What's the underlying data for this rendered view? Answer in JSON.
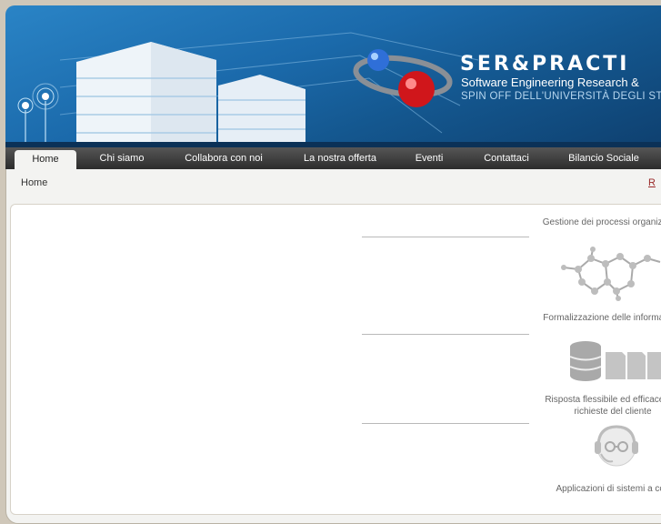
{
  "header": {
    "title": "SER&PRACTI",
    "subtitle": "Software Engineering Research &",
    "spin_off": "SPIN OFF DELL'UNIVERSITÀ DEGLI ST"
  },
  "nav": {
    "items": [
      "Home",
      "Chi siamo",
      "Collabora con noi",
      "La nostra offerta",
      "Eventi",
      "Contattaci",
      "Bilancio Sociale"
    ],
    "active": "Home"
  },
  "breadcrumb": {
    "current": "Home",
    "right_link": "R"
  },
  "features": [
    {
      "label": "Gestione dei processi organizzativi",
      "icon": "molecule-network-icon"
    },
    {
      "label": "Formalizzazione delle informazioni",
      "icon": "database-documents-icon"
    },
    {
      "label": "Risposta flessibile ed efficace alle richieste del cliente",
      "icon": "headset-face-icon"
    },
    {
      "label": "Applicazioni di sistemi a con",
      "icon": ""
    }
  ],
  "colors": {
    "banner_top": "#2a84c6",
    "banner_bottom": "#0e3f6e",
    "nav": "#2c2c2c",
    "page_bg": "#cfc7b9"
  }
}
